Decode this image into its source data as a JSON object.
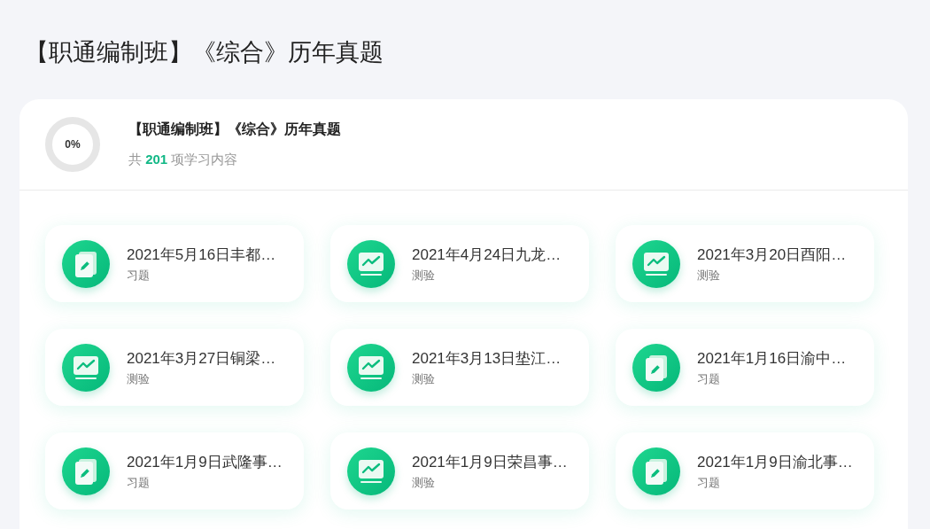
{
  "page_title": "【职通编制班】《综合》历年真题",
  "course": {
    "progress": {
      "label": "0%",
      "level": 0
    },
    "title": "【职通编制班】《综合》历年真题",
    "summary": "共 **201** 项学习内容"
  },
  "items": [
    {
      "kind": "exercise",
      "title": "2021年5月16日丰都…",
      "type_label": "习题"
    },
    {
      "kind": "test",
      "title": "2021年4月24日九龙…",
      "type_label": "测验"
    },
    {
      "kind": "test",
      "title": "2021年3月20日酉阳…",
      "type_label": "测验"
    },
    {
      "kind": "test",
      "title": "2021年3月27日铜梁…",
      "type_label": "测验"
    },
    {
      "kind": "test",
      "title": "2021年3月13日垫江…",
      "type_label": "测验"
    },
    {
      "kind": "exercise",
      "title": "2021年1月16日渝中…",
      "type_label": "习题"
    },
    {
      "kind": "exercise",
      "title": "2021年1月9日武隆事…",
      "type_label": "习题"
    },
    {
      "kind": "test",
      "title": "2021年1月9日荣昌事…",
      "type_label": "测验"
    },
    {
      "kind": "exercise",
      "title": "2021年1月9日渝北事…",
      "type_label": "习题"
    }
  ]
}
